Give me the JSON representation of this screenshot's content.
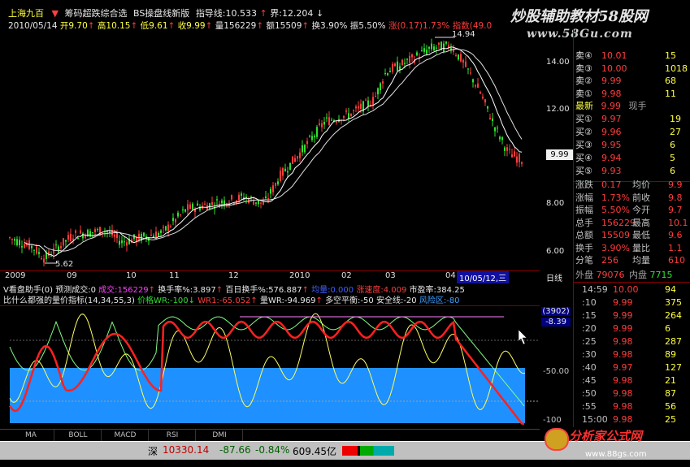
{
  "header": {
    "title": "上海九百",
    "menu": "筹码超跌综合选",
    "menu2": "BS操盘线新版",
    "guide_label": "指导线:10.533",
    "boundary_label": "界:12.204",
    "watermark_top": "炒股辅助教材58股网",
    "watermark_url": "www.58Gu.com"
  },
  "ohlc": {
    "date": "2010/05/14",
    "open": "开9.70",
    "high": "高10.15",
    "low": "低9.61",
    "close": "收9.99",
    "volume": "量156229",
    "amount": "额15509",
    "turnover": "换3.90%",
    "amplitude": "振5.50%",
    "change": "涨(0.17)1.73%",
    "index": "指数(49.0"
  },
  "main_chart": {
    "price_labels": {
      "high": "14.94",
      "low": "5.62",
      "current": "9.99"
    },
    "y_ticks": [
      "14.00",
      "12.00",
      "10.00",
      "8.00",
      "6.00"
    ],
    "y_values": [
      14,
      12,
      10,
      8,
      6
    ],
    "y_range": [
      5.3,
      15.4
    ],
    "x_labels": [
      "2009",
      "09",
      "10",
      "11",
      "12",
      "2010",
      "02",
      "03",
      "04"
    ],
    "x_cursor_label": "10/05/12,三",
    "x_axis_right": "日线"
  },
  "indicator1": {
    "name": "V看盘助手(0)",
    "predict": "预测成交:0",
    "volume": "成交:156229",
    "turnover": "换手率%:3.897",
    "hundred_day": "百日换手%:576.887",
    "extra1": "均量:0.000",
    "speed": "涨速度:4.009",
    "pe": "市盈率:384.25"
  },
  "indicator2": {
    "name": "比什么都强的量价指标(14,34,55,3)",
    "price_wr": "价格WR:-100",
    "wr1": "WR1:-65.052",
    "vol_wr": "量WR:-94.969",
    "balance": "多空平衡:-50",
    "safe": "安全线:-20",
    "risk": "风险区:-80"
  },
  "sub_chart": {
    "y_label_top": "(3902)",
    "y_label_value": "-8.39",
    "y_tick_mid": "-50.00",
    "y_tick_bottom": "-100"
  },
  "tabs": [
    "MA",
    "BOLL",
    "MACD",
    "RSI",
    "DMI"
  ],
  "status": {
    "market": "深",
    "index_value": "10330.14",
    "change": "-87.66",
    "pct": "-0.84%",
    "turnover": "609.45亿"
  },
  "quote_panel": {
    "sells": [
      {
        "label": "卖④",
        "price": "10.01",
        "vol": "15"
      },
      {
        "label": "卖③",
        "price": "10.00",
        "vol": "1018"
      },
      {
        "label": "卖②",
        "price": "9.99",
        "vol": "68"
      },
      {
        "label": "卖①",
        "price": "9.98",
        "vol": "11"
      }
    ],
    "latest": {
      "label": "最新",
      "price": "9.99",
      "extra": "现手"
    },
    "buys": [
      {
        "label": "买①",
        "price": "9.97",
        "vol": "19"
      },
      {
        "label": "买②",
        "price": "9.96",
        "vol": "27"
      },
      {
        "label": "买③",
        "price": "9.95",
        "vol": "6"
      },
      {
        "label": "买④",
        "price": "9.94",
        "vol": "5"
      },
      {
        "label": "买⑤",
        "price": "9.93",
        "vol": "6"
      }
    ],
    "stats": [
      {
        "k1": "涨跌",
        "v1": "0.17",
        "k2": "均价",
        "v2": "9.9"
      },
      {
        "k1": "涨幅",
        "v1": "1.73%",
        "k2": "前收",
        "v2": "9.8"
      },
      {
        "k1": "振幅",
        "v1": "5.50%",
        "k2": "今开",
        "v2": "9.7"
      },
      {
        "k1": "总手",
        "v1": "156229",
        "k2": "最高",
        "v2": "10.1"
      },
      {
        "k1": "总额",
        "v1": "15509",
        "k2": "最低",
        "v2": "9.6"
      },
      {
        "k1": "换手",
        "v1": "3.90%",
        "k2": "量比",
        "v2": "1.1"
      },
      {
        "k1": "分笔",
        "v1": "256",
        "k2": "均量",
        "v2": "610"
      }
    ],
    "outer": {
      "label": "外盘",
      "value": "79076",
      "label2": "内盘",
      "value2": "7715"
    },
    "ticks": [
      {
        "time": "14:59",
        "price": "10.00",
        "vol": "94"
      },
      {
        "time": ":10",
        "price": "9.99",
        "vol": "375"
      },
      {
        "time": ":15",
        "price": "9.99",
        "vol": "264"
      },
      {
        "time": ":20",
        "price": "9.99",
        "vol": "6"
      },
      {
        "time": ":25",
        "price": "9.98",
        "vol": "287"
      },
      {
        "time": ":30",
        "price": "9.98",
        "vol": "89"
      },
      {
        "time": ":40",
        "price": "9.97",
        "vol": "127"
      },
      {
        "time": ":45",
        "price": "9.98",
        "vol": "21"
      },
      {
        "time": ":50",
        "price": "9.98",
        "vol": "87"
      },
      {
        "time": ":55",
        "price": "9.98",
        "vol": "56"
      },
      {
        "time": "15:00",
        "price": "9.98",
        "vol": "25"
      }
    ]
  },
  "watermark_bottom": {
    "name": "分析家公式网",
    "url": "www.88gs.com"
  },
  "colors": {
    "up": "#ff3c3c",
    "down": "#30e030",
    "bg": "#000000",
    "blue_zone": "#1e90ff"
  }
}
